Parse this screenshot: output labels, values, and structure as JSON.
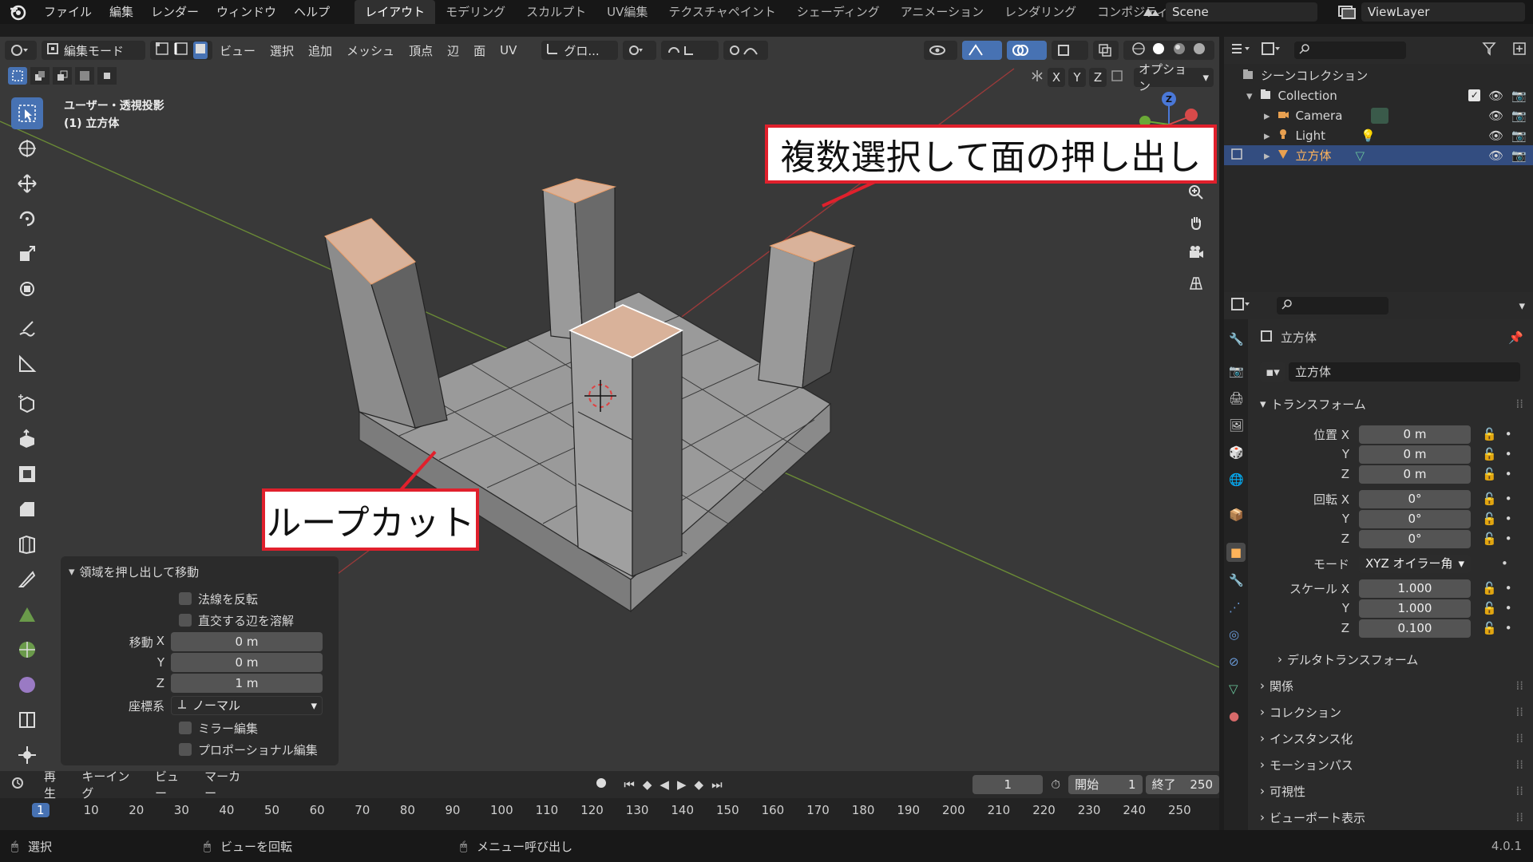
{
  "app": {
    "menus": [
      "ファイル",
      "編集",
      "レンダー",
      "ウィンドウ",
      "ヘルプ"
    ],
    "workspace_tabs": [
      "レイアウト",
      "モデリング",
      "スカルプト",
      "UV編集",
      "テクスチャペイント",
      "シェーディング",
      "アニメーション",
      "レンダリング",
      "コンポジティング"
    ],
    "active_tab": "レイアウト",
    "scene": "Scene",
    "view_layer": "ViewLayer",
    "version": "4.0.1"
  },
  "viewport_header": {
    "mode": "編集モード",
    "menus": [
      "ビュー",
      "選択",
      "追加",
      "メッシュ",
      "頂点",
      "辺",
      "面",
      "UV"
    ],
    "transform_orientation": "グロ...",
    "axes": [
      "X",
      "Y",
      "Z"
    ],
    "options": "オプション"
  },
  "viewport": {
    "view_name": "ユーザー・透視投影",
    "object_name": "(1) 立方体"
  },
  "callouts": {
    "extrude": "複数選択して面の押し出し",
    "loopcut": "ループカット"
  },
  "operator_panel": {
    "title": "領域を押し出して移動",
    "flip_normals": "法線を反転",
    "dissolve_orthogonal": "直交する辺を溶解",
    "move_label": "移動",
    "x_label": "X",
    "y_label": "Y",
    "z_label": "Z",
    "move_x": "0 m",
    "move_y": "0 m",
    "move_z": "1 m",
    "orientation_label": "座標系",
    "orientation_value": "ノーマル",
    "mirror": "ミラー編集",
    "proportional": "プロポーショナル編集"
  },
  "timeline": {
    "menus": [
      "再生",
      "キーイング",
      "ビュー",
      "マーカー"
    ],
    "current_frame": "1",
    "start_label": "開始",
    "start_value": "1",
    "end_label": "終了",
    "end_value": "250",
    "ruler": [
      "1",
      "10",
      "20",
      "30",
      "40",
      "50",
      "60",
      "70",
      "80",
      "90",
      "100",
      "110",
      "120",
      "130",
      "140",
      "150",
      "160",
      "170",
      "180",
      "190",
      "200",
      "210",
      "220",
      "230",
      "240",
      "250"
    ]
  },
  "statusbar": {
    "select": "選択",
    "rotate": "ビューを回転",
    "menu": "メニュー呼び出し"
  },
  "outliner": {
    "root": "シーンコレクション",
    "collection": "Collection",
    "items": [
      "Camera",
      "Light",
      "立方体"
    ]
  },
  "properties": {
    "object_name": "立方体",
    "data_name": "立方体",
    "transform_title": "トランスフォーム",
    "location_label": "位置 X",
    "rotation_label": "回転 X",
    "scale_label": "スケール X",
    "y_label": "Y",
    "z_label": "Z",
    "location": [
      "0 m",
      "0 m",
      "0 m"
    ],
    "rotation": [
      "0°",
      "0°",
      "0°"
    ],
    "scale": [
      "1.000",
      "1.000",
      "0.100"
    ],
    "mode_label": "モード",
    "mode_value": "XYZ オイラー角",
    "delta": "デルタトランスフォーム",
    "sections": [
      "関係",
      "コレクション",
      "インスタンス化",
      "モーションパス",
      "可視性",
      "ビューポート表示"
    ]
  },
  "colors": {
    "accent": "#4772b3",
    "callout_border": "#e0202c",
    "selected_face": "#d9b29a"
  }
}
